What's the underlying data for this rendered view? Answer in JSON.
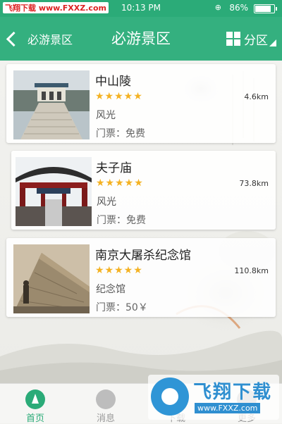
{
  "status_bar": {
    "watermark": "飞翔下载 www.FXXZ.com",
    "time": "10:13 PM",
    "battery": "86%",
    "rotation_lock": "⊕"
  },
  "nav": {
    "back_label": "必游景区",
    "title": "必游景区",
    "district_label": "分区"
  },
  "colors": {
    "accent": "#34b07f",
    "star": "#f4b223"
  },
  "spots": [
    {
      "name": "中山陵",
      "stars": "★★★★★",
      "distance": "4.6km",
      "type": "风光",
      "ticket": "门票：免费"
    },
    {
      "name": "夫子庙",
      "stars": "★★★★★",
      "distance": "73.8km",
      "type": "风光",
      "ticket": "门票：免费"
    },
    {
      "name": "南京大屠杀纪念馆",
      "stars": "★★★★★",
      "distance": "110.8km",
      "type": "纪念馆",
      "ticket": "门票：50￥"
    }
  ],
  "tabs": [
    {
      "label": "首页",
      "icon": "home-icon"
    },
    {
      "label": "消息",
      "icon": "message-icon"
    },
    {
      "label": "下载",
      "icon": "download-icon"
    },
    {
      "label": "更多",
      "icon": "more-icon"
    }
  ],
  "overlay": {
    "title": "飞翔下载",
    "url": "www.FXXZ.com"
  }
}
